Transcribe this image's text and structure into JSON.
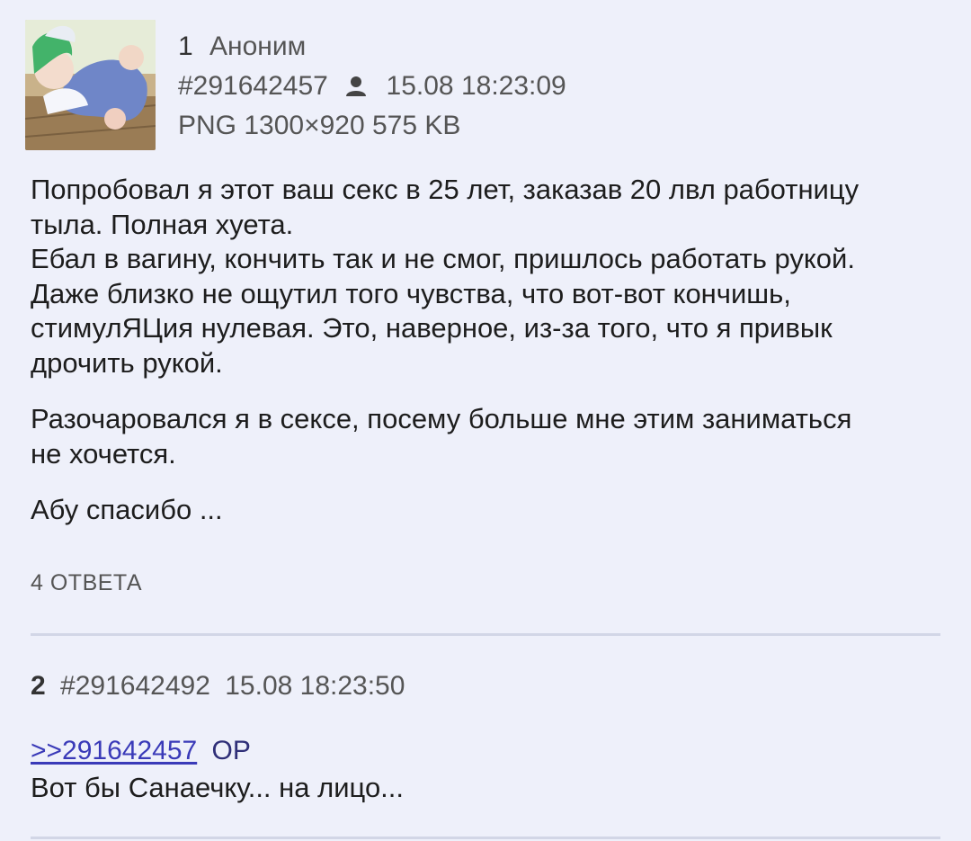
{
  "post1": {
    "number": "1",
    "author": "Аноним",
    "post_id": "#291642457",
    "datetime": "15.08 18:23:09",
    "file_info": "PNG 1300×920 575 KB",
    "thumbnail_icon": "anime-thumbnail-image",
    "paragraphs": [
      "Попробовал я этот ваш секс в 25 лет, заказав 20 лвл работницу\nтыла. Полная хуета.\nЕбал в вагину, кончить так и не смог, пришлось работать рукой.\nДаже близко не ощутил того чувства, что вот-вот кончишь,\nстимулЯЦия нулевая. Это, наверное, из-за того, что я привык\nдрочить рукой.",
      "Разочаровался я в сексе, посему больше мне этим заниматься\nне хочется.",
      "Абу спасибо ..."
    ],
    "replies_label": "4 ОТВЕТА"
  },
  "post2": {
    "number": "2",
    "post_id": "#291642492",
    "datetime": "15.08 18:23:50",
    "reply_link": ">>291642457",
    "op_tag": "OP",
    "text": "Вот бы Санаечку... на лицо..."
  },
  "colors": {
    "background": "#eef0fa",
    "link": "#3a3ab8",
    "op_tag": "#2f2f78",
    "divider": "#d2d6e6"
  }
}
